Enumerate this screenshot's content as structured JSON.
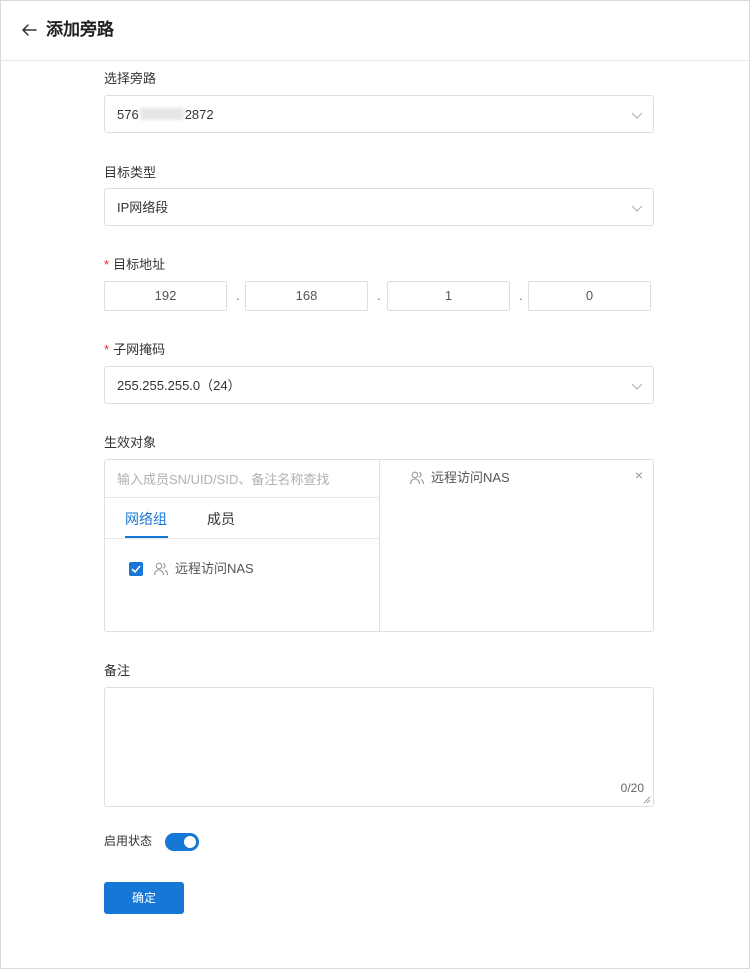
{
  "header": {
    "title": "添加旁路"
  },
  "form": {
    "bypass": {
      "label": "选择旁路",
      "value_prefix": "576",
      "value_suffix": "2872"
    },
    "target_type": {
      "label": "目标类型",
      "value": "IP网络段"
    },
    "target_address": {
      "label": "目标地址",
      "required_mark": "*",
      "octets": [
        "192",
        "168",
        "1",
        "0"
      ],
      "separator": "."
    },
    "subnet_mask": {
      "label": "子网掩码",
      "required_mark": "*",
      "value": "255.255.255.0（24）"
    },
    "effective_target": {
      "label": "生效对象",
      "search_placeholder": "输入成员SN/UID/SID、备注名称查找",
      "tabs": [
        {
          "label": "网络组"
        },
        {
          "label": "成员"
        }
      ],
      "items": [
        {
          "label": "远程访问NAS",
          "checked": true
        }
      ],
      "selected": [
        {
          "label": "远程访问NAS"
        }
      ],
      "remove_glyph": "×"
    },
    "remark": {
      "label": "备注",
      "counter": "0/20"
    },
    "status": {
      "label": "启用状态",
      "enabled": true
    },
    "submit": {
      "label": "确定"
    }
  },
  "colors": {
    "accent": "#1677d6",
    "required": "#f5222d",
    "border": "#dcdfe6"
  },
  "icons": {
    "back": "arrow-left-icon",
    "dropdown": "chevron-down-icon",
    "user": "user-group-icon",
    "close": "close-icon",
    "check": "check-icon"
  }
}
